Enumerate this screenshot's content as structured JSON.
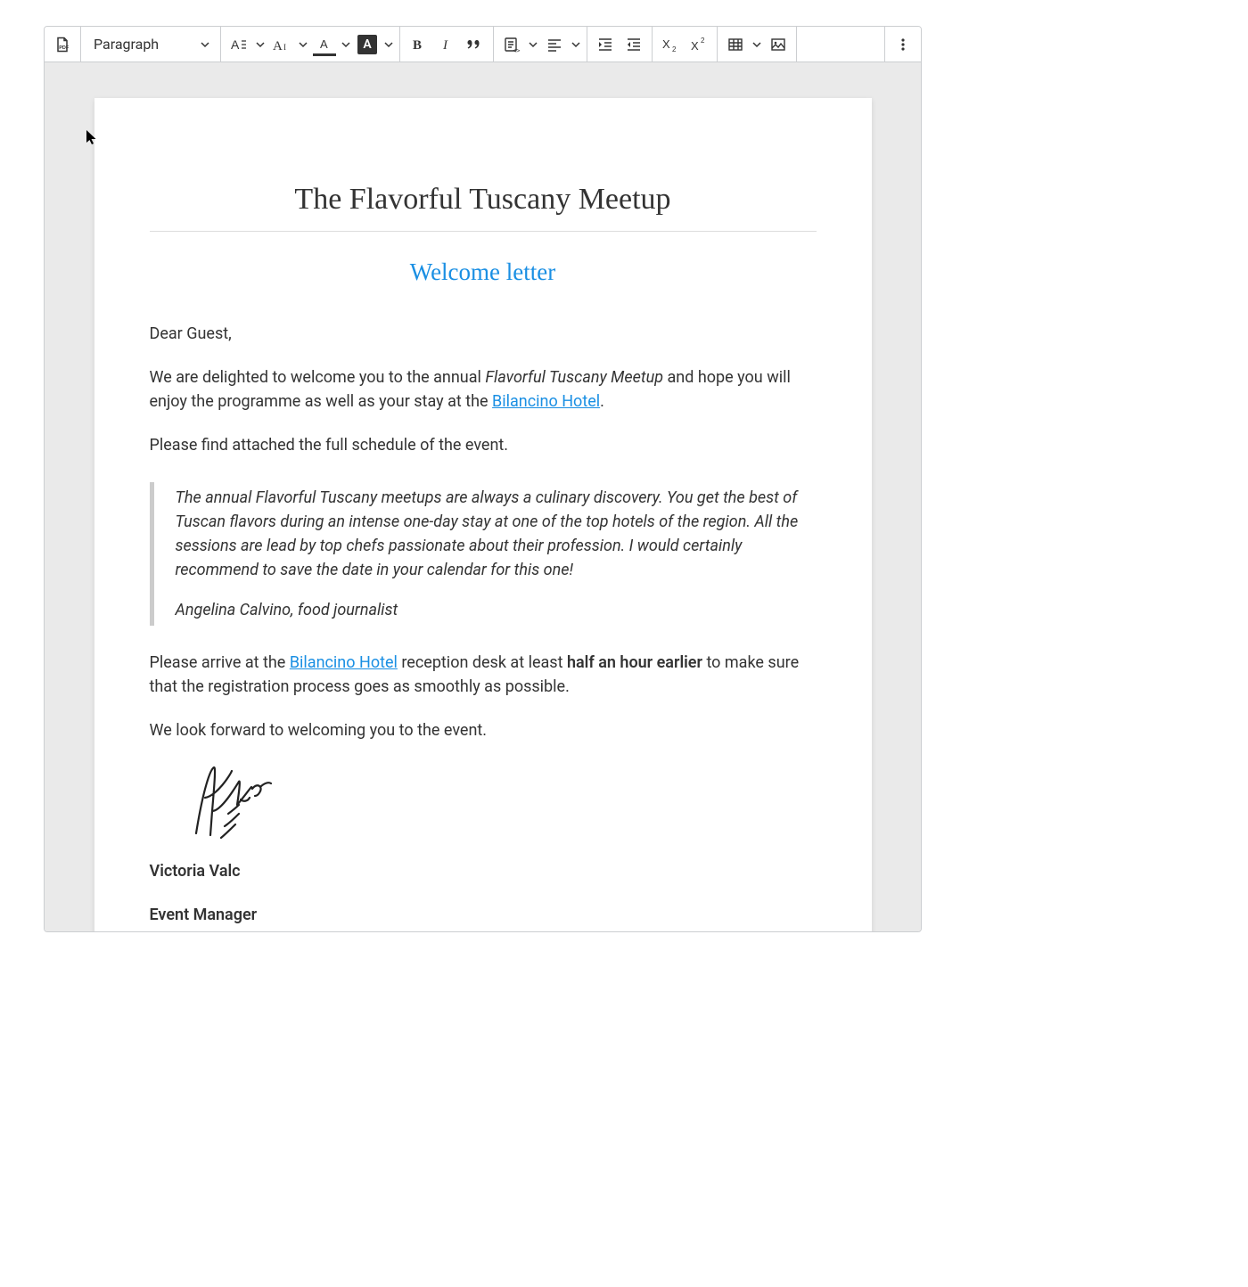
{
  "toolbar": {
    "heading_select": "Paragraph"
  },
  "document": {
    "title": "The Flavorful Tuscany Meetup",
    "subtitle": "Welcome letter",
    "greeting": "Dear Guest,",
    "p1_a": "We are delighted to welcome you to the annual ",
    "p1_em": "Flavorful Tuscany Meetup",
    "p1_b": " and hope you will enjoy the programme as well as your stay at the ",
    "p1_link": "Bilancino Hotel",
    "p1_c": ".",
    "p2": "Please find attached the full schedule of the event.",
    "quote_text": "The annual Flavorful Tuscany meetups are always a culinary discovery. You get the best of Tuscan flavors during an intense one-day stay at one of the top hotels of the region. All the sessions are lead by top chefs passionate about their profession. I would certainly recommend to save the date in your calendar for this one!",
    "quote_author": "Angelina Calvino, food journalist",
    "p3_a": "Please arrive at the ",
    "p3_link": "Bilancino Hotel",
    "p3_b": " reception desk at least ",
    "p3_strong": "half an hour earlier",
    "p3_c": " to make sure that the registration process goes as smoothly as possible.",
    "p4": "We look forward to welcoming you to the event.",
    "sig_name": "Victoria Valc",
    "sig_role": "Event Manager"
  }
}
